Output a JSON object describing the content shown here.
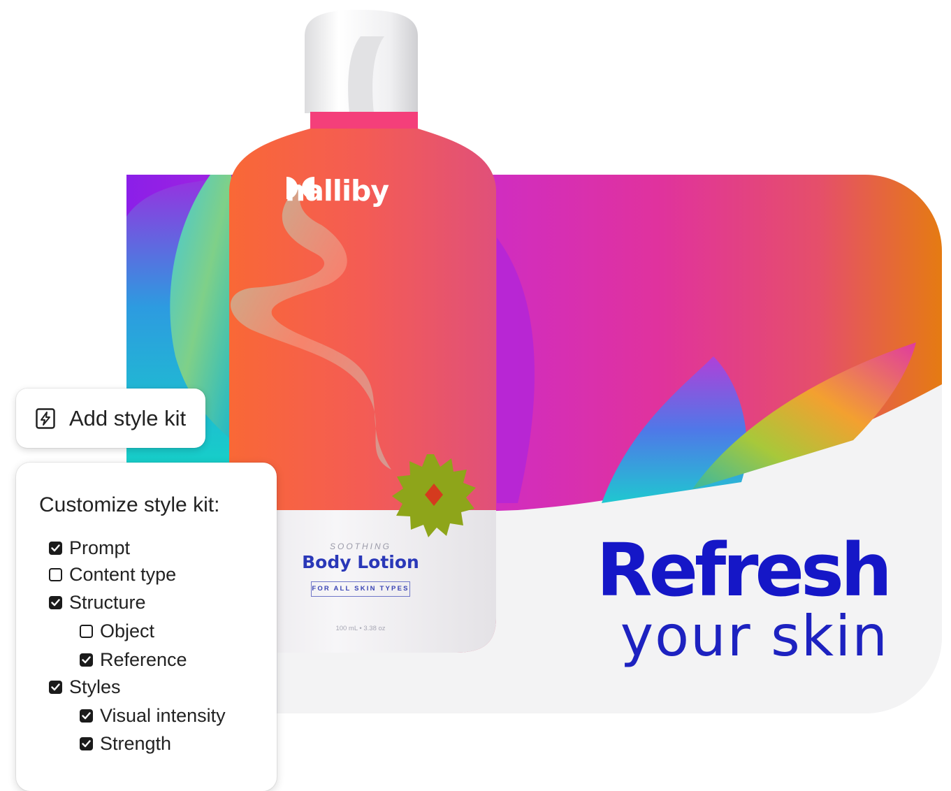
{
  "add_style_kit": {
    "label": "Add style kit",
    "icon": "lightning-icon"
  },
  "customize": {
    "title": "Customize style kit:",
    "options": [
      {
        "label": "Prompt",
        "checked": true,
        "level": 0
      },
      {
        "label": "Content type",
        "checked": false,
        "level": 0
      },
      {
        "label": "Structure",
        "checked": true,
        "level": 0
      },
      {
        "label": "Object",
        "checked": false,
        "level": 1
      },
      {
        "label": "Reference",
        "checked": true,
        "level": 1
      },
      {
        "label": "Styles",
        "checked": true,
        "level": 0
      },
      {
        "label": "Visual intensity",
        "checked": true,
        "level": 1
      },
      {
        "label": "Strength",
        "checked": true,
        "level": 1
      }
    ]
  },
  "bottle": {
    "brand": "halliby",
    "tagline": "SOOTHING",
    "product": "Body Lotion",
    "skin_types": "FOR ALL SKIN TYPES",
    "volume": "100 mL • 3.38 oz"
  },
  "headline": {
    "line1": "Refresh",
    "line2": "your skin"
  },
  "colors": {
    "headline": "#1517c7",
    "gradient_pink": "#e0329e",
    "gradient_orange": "#e57b12",
    "bottle_coral": "#f45a4e"
  }
}
